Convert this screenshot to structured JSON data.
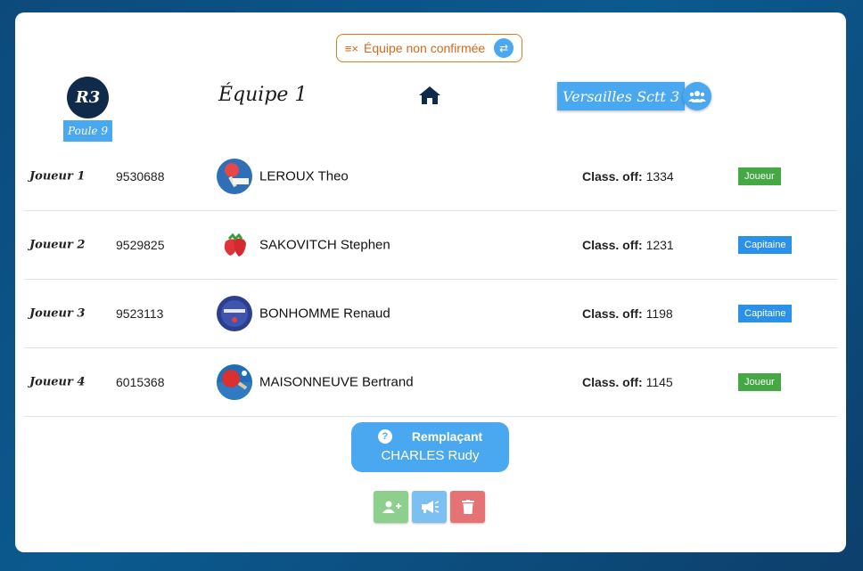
{
  "status": {
    "label": "Équipe non confirmée",
    "color": "#d2691e",
    "icon": "swap-icon"
  },
  "header": {
    "division": "R3",
    "pool": "Poule 9",
    "team_title": "Équipe 1",
    "home_icon": "home-icon",
    "club": "Versailles Sctt 3",
    "club_icon": "people-icon"
  },
  "players": [
    {
      "slot": "Joueur 1",
      "license": "9530688",
      "name": "LEROUX Theo",
      "rating_label": "Class. off:",
      "rating": "1334",
      "role": "Joueur",
      "avatar": "pingpong-paddle-avatar"
    },
    {
      "slot": "Joueur 2",
      "license": "9529825",
      "name": "SAKOVITCH Stephen",
      "rating_label": "Class. off:",
      "rating": "1231",
      "role": "Capitaine",
      "avatar": "strawberry-avatar"
    },
    {
      "slot": "Joueur 3",
      "license": "9523113",
      "name": "BONHOMME Renaud",
      "rating_label": "Class. off:",
      "rating": "1198",
      "role": "Capitaine",
      "avatar": "pingpong-logo-avatar"
    },
    {
      "slot": "Joueur 4",
      "license": "6015368",
      "name": "MAISONNEUVE Bertrand",
      "rating_label": "Class. off:",
      "rating": "1145",
      "role": "Joueur",
      "avatar": "table-tennis-avatar"
    }
  ],
  "substitute": {
    "title": "Remplaçant",
    "name": "CHARLES Rudy",
    "help_icon": "?"
  },
  "actions": [
    {
      "name": "add-player-button",
      "icon": "user-plus-icon",
      "color": "#8dd08d"
    },
    {
      "name": "announce-button",
      "icon": "megaphone-icon",
      "color": "#7cc0f2"
    },
    {
      "name": "delete-button",
      "icon": "trash-icon",
      "color": "#e67373"
    }
  ],
  "colors": {
    "accent": "#4aa8f0",
    "joueur": "#45a845",
    "capitaine": "#2a90e8",
    "navy": "#102a4c"
  }
}
